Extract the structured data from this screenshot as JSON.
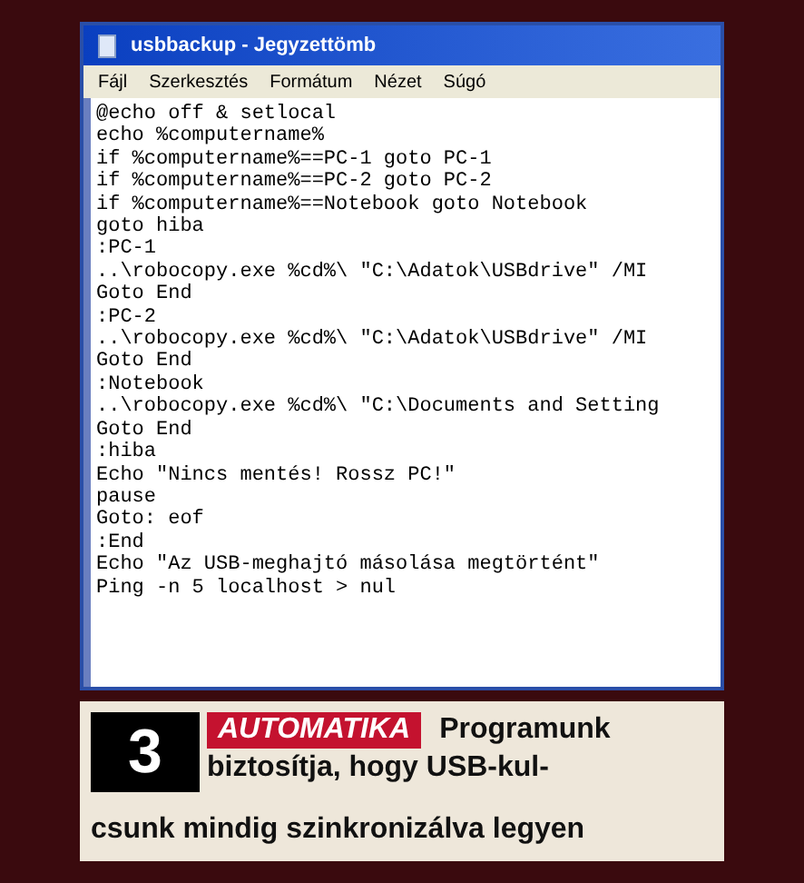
{
  "window": {
    "title": "usbbackup - Jegyzettömb"
  },
  "menu": [
    "Fájl",
    "Szerkesztés",
    "Formátum",
    "Nézet",
    "Súgó"
  ],
  "lines": [
    "@echo off & setlocal",
    "echo %computername%",
    "if %computername%==PC-1 goto PC-1",
    "if %computername%==PC-2 goto PC-2",
    "if %computername%==Notebook goto Notebook",
    "goto hiba",
    ":PC-1",
    "..\\robocopy.exe %cd%\\ \"C:\\Adatok\\USBdrive\" /MI",
    "Goto End",
    ":PC-2",
    "..\\robocopy.exe %cd%\\ \"C:\\Adatok\\USBdrive\" /MI",
    "Goto End",
    ":Notebook",
    "..\\robocopy.exe %cd%\\ \"C:\\Documents and Setting",
    "Goto End",
    ":hiba",
    "Echo \"Nincs mentés! Rossz PC!\"",
    "pause",
    "Goto: eof",
    ":End",
    "Echo \"Az USB-meghajtó másolása megtörtént\"",
    "Ping -n 5 localhost > nul"
  ],
  "caption": {
    "number": "3",
    "tag": "AUTOMATIKA",
    "lines": [
      "Programunk",
      "biztosítja, hogy USB-kul-",
      "csunk mindig szinkronizálva legyen"
    ]
  }
}
